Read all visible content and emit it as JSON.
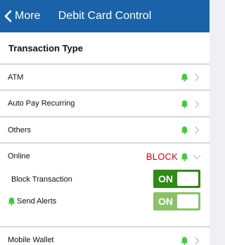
{
  "nav": {
    "back_label": "More",
    "title": "Debit Card Control"
  },
  "section": {
    "title": "Transaction Type"
  },
  "rows": [
    {
      "label": "ATM"
    },
    {
      "label": "Auto Pay Recurring"
    },
    {
      "label": "Others"
    },
    {
      "label": "Online",
      "status": "BLOCK"
    },
    {
      "label": "Mobile Wallet"
    }
  ],
  "online_options": {
    "block_transaction": {
      "label": "Block Transaction",
      "toggle": "ON"
    },
    "send_alerts": {
      "label": "Send Alerts",
      "toggle": "ON"
    }
  },
  "colors": {
    "nav_bar": "#1a63a8",
    "bell": "#3ccc3c",
    "block_text": "#e00000",
    "toggle_on_dark": "#2e8b15",
    "toggle_on_light": "#8cc16a"
  },
  "icons": {
    "back": "chevron-left-icon",
    "alert": "bell-icon",
    "disclosure": "chevron-right-icon",
    "expanded": "chevron-down-icon"
  }
}
